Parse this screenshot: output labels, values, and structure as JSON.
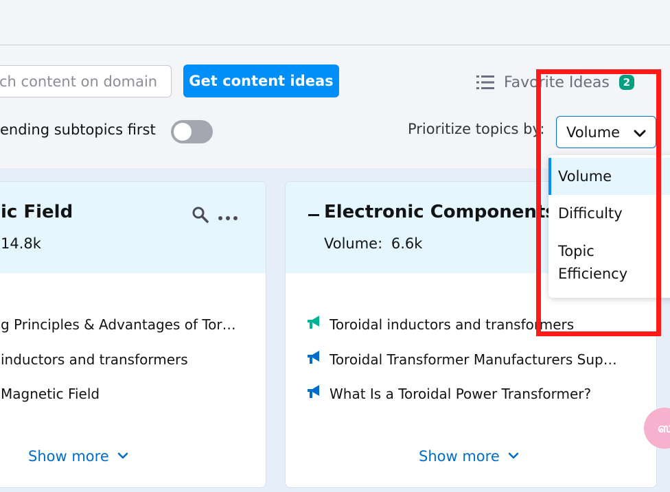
{
  "toolbar": {
    "search_placeholder": "ch content on domain",
    "cta_label": "Get content ideas",
    "favorites_label": "Favorite Ideas",
    "favorites_count": "2"
  },
  "filters": {
    "trending_label": "ending subtopics first",
    "trending_enabled": false,
    "prioritize_label": "Prioritize topics by:",
    "prioritize_value": "Volume",
    "prioritize_options": [
      "Volume",
      "Difficulty",
      "Topic Efficiency"
    ],
    "prioritize_option_lines": [
      [
        "Volume"
      ],
      [
        "Difficulty"
      ],
      [
        "Topic",
        "Efficiency"
      ]
    ]
  },
  "cards": {
    "left": {
      "title": "ic Field",
      "volume_label": "14.8k",
      "items": [
        "g Principles & Advantages of Tor…",
        "inductors and transformers",
        "Magnetic Field"
      ],
      "show_more": "Show more"
    },
    "right": {
      "title": "Electronic Components",
      "volume_label": "Volume:",
      "volume_value": "6.6k",
      "items": [
        "Toroidal inductors and transformers",
        "Toroidal Transformer Manufacturers Sup…",
        "What Is a Toroidal Power Transformer?"
      ],
      "show_more": "Show more"
    }
  },
  "widgets": {
    "chat_bubble_glyph": "ஸ"
  },
  "colors": {
    "accent": "#008ff8",
    "link": "#006dca",
    "badge_green": "#009f81",
    "highlight_red": "#ff1a1a",
    "card_header": "#e5f6ff"
  }
}
